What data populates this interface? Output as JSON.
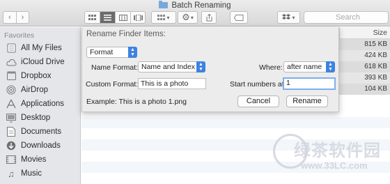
{
  "window": {
    "title": "Batch Renaming"
  },
  "toolbar": {
    "back_icon": "chevron-left-icon",
    "forward_icon": "chevron-right-icon",
    "view_modes": [
      "icon-view",
      "list-view",
      "column-view",
      "cover-flow-view"
    ],
    "active_view": "list-view",
    "search_placeholder": "Search",
    "action_icon": "gear-icon",
    "share_icon": "share-icon",
    "tag_icon": "tag-icon",
    "dropbox_icon": "dropbox-icon"
  },
  "sidebar": {
    "heading": "Favorites",
    "items": [
      {
        "label": "All My Files",
        "icon": "all-files-icon"
      },
      {
        "label": "iCloud Drive",
        "icon": "cloud-icon"
      },
      {
        "label": "Dropbox",
        "icon": "dropbox-icon"
      },
      {
        "label": "AirDrop",
        "icon": "airdrop-icon"
      },
      {
        "label": "Applications",
        "icon": "applications-icon"
      },
      {
        "label": "Desktop",
        "icon": "desktop-icon"
      },
      {
        "label": "Documents",
        "icon": "documents-icon"
      },
      {
        "label": "Downloads",
        "icon": "downloads-icon"
      },
      {
        "label": "Movies",
        "icon": "movies-icon"
      },
      {
        "label": "Music",
        "icon": "music-icon"
      }
    ]
  },
  "file_list": {
    "size_header": "Size",
    "sizes": [
      "815 KB",
      "424 KB",
      "618 KB",
      "393 KB",
      "104 KB"
    ]
  },
  "sheet": {
    "title": "Rename Finder Items:",
    "mode_popup": "Format",
    "name_format_label": "Name Format:",
    "name_format_value": "Name and Index",
    "where_label": "Where:",
    "where_value": "after name",
    "custom_format_label": "Custom Format:",
    "custom_format_value": "This is a photo",
    "start_numbers_label": "Start numbers at:",
    "start_numbers_value": "1",
    "example": "Example: This is a photo 1.png",
    "cancel_label": "Cancel",
    "rename_label": "Rename"
  },
  "watermark": {
    "text_cn": "绿茶软件园",
    "url": "www.33LC.com"
  },
  "colors": {
    "accent": "#3d82e0",
    "focus_ring": "#7eaef0",
    "sidebar_bg": "#e4e6e9"
  }
}
